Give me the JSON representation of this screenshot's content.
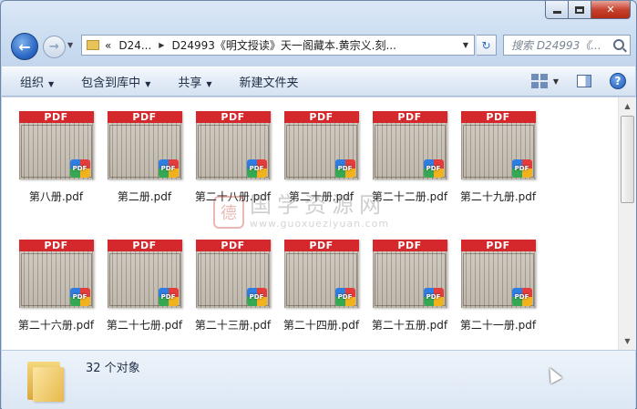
{
  "window": {
    "caption": {
      "close_label": "✕"
    }
  },
  "nav": {
    "back_label": "←",
    "forward_label": "→",
    "breadcrumb": [
      "«",
      "D24...",
      "D24993《明文授读》天一阁藏本.黄宗义.刻..."
    ],
    "refresh_label": "↻",
    "search_placeholder": "搜索 D24993《..."
  },
  "toolbar": {
    "items": [
      {
        "label": "组织",
        "has_dropdown": true
      },
      {
        "label": "包含到库中",
        "has_dropdown": true
      },
      {
        "label": "共享",
        "has_dropdown": true
      },
      {
        "label": "新建文件夹",
        "has_dropdown": false
      }
    ],
    "help_label": "?"
  },
  "files": [
    {
      "name": "第八册.pdf",
      "band": "PDF",
      "badge": "PDF"
    },
    {
      "name": "第二册.pdf",
      "band": "PDF",
      "badge": "PDF"
    },
    {
      "name": "第二十八册.pdf",
      "band": "PDF",
      "badge": "PDF"
    },
    {
      "name": "第二十册.pdf",
      "band": "PDF",
      "badge": "PDF"
    },
    {
      "name": "第二十二册.pdf",
      "band": "PDF",
      "badge": "PDF"
    },
    {
      "name": "第二十九册.pdf",
      "band": "PDF",
      "badge": "PDF"
    },
    {
      "name": "第二十六册.pdf",
      "band": "PDF",
      "badge": "PDF"
    },
    {
      "name": "第二十七册.pdf",
      "band": "PDF",
      "badge": "PDF"
    },
    {
      "name": "第二十三册.pdf",
      "band": "PDF",
      "badge": "PDF"
    },
    {
      "name": "第二十四册.pdf",
      "band": "PDF",
      "badge": "PDF"
    },
    {
      "name": "第二十五册.pdf",
      "band": "PDF",
      "badge": "PDF"
    },
    {
      "name": "第二十一册.pdf",
      "band": "PDF",
      "badge": "PDF"
    }
  ],
  "watermark": {
    "seal": "德",
    "text": "国学资源网",
    "url": "www.guoxueziyuan.com"
  },
  "status": {
    "count_text": "32 个对象"
  },
  "colors": {
    "pdf_band": "#d5282c",
    "window_border": "#6d87a8",
    "close_button": "#c7432f"
  }
}
